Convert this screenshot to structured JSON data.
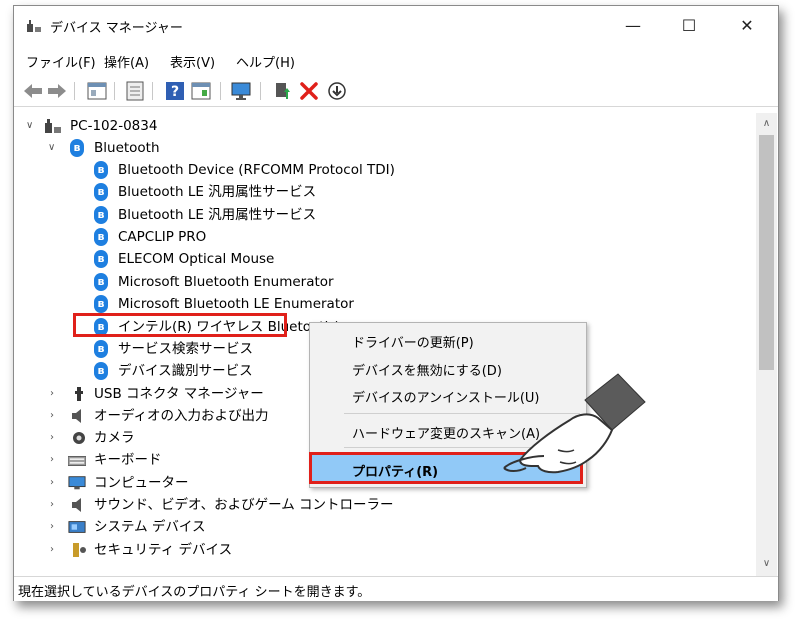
{
  "window": {
    "title": "デバイス マネージャー",
    "minimize": "—",
    "maximize": "☐",
    "close": "✕"
  },
  "menu": [
    "ファイル(F)",
    "操作(A)",
    "表示(V)",
    "ヘルプ(H)"
  ],
  "toolbar": {
    "icons": [
      "back-arrow-icon",
      "forward-arrow-icon",
      "properties-icon",
      "document-icon",
      "help-icon",
      "view-icon",
      "monitor-icon",
      "update-driver-icon",
      "uninstall-icon",
      "download-icon"
    ]
  },
  "tree": {
    "root": "PC-102-0834",
    "bluetooth": {
      "label": "Bluetooth",
      "children": [
        "Bluetooth Device (RFCOMM Protocol TDI)",
        "Bluetooth LE 汎用属性サービス",
        "Bluetooth LE 汎用属性サービス",
        "CAPCLIP PRO",
        "ELECOM Optical Mouse",
        "Microsoft Bluetooth Enumerator",
        "Microsoft Bluetooth LE Enumerator",
        "インテル(R) ワイヤレス Bluetooth(",
        "サービス検索サービス",
        "デバイス識別サービス"
      ]
    },
    "categories": [
      "USB コネクタ マネージャー",
      "オーディオの入力および出力",
      "カメラ",
      "キーボード",
      "コンピューター",
      "サウンド、ビデオ、およびゲーム コントローラー",
      "システム デバイス",
      "セキュリティ デバイス"
    ]
  },
  "context_menu": {
    "update_driver": "ドライバーの更新(P)",
    "disable": "デバイスを無効にする(D)",
    "uninstall": "デバイスのアンインストール(U)",
    "scan": "ハードウェア変更のスキャン(A)",
    "properties": "プロパティ(R)"
  },
  "status": "現在選択しているデバイスのプロパティ シートを開きます。",
  "colors": {
    "bluetooth_blue": "#1e7fe0",
    "highlight_red": "#e0201a",
    "menu_hover_blue": "#91c9f7",
    "selection_blue": "#cce8ff"
  }
}
